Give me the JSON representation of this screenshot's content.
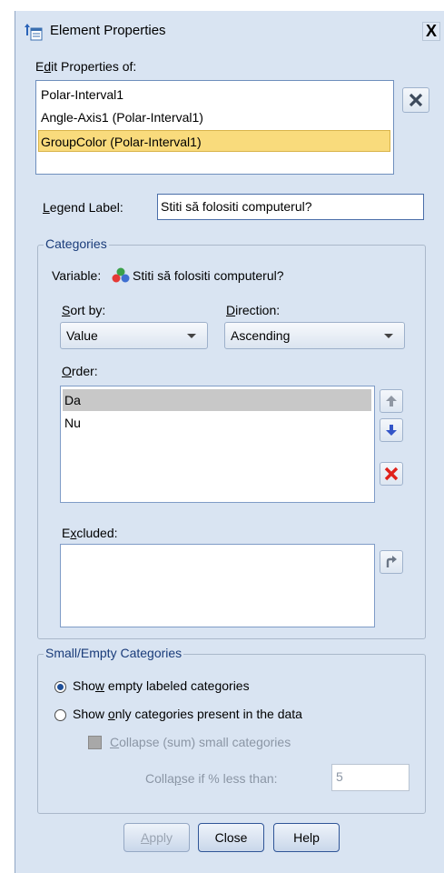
{
  "window": {
    "title": "Element Properties",
    "close_glyph": "X"
  },
  "edit_properties": {
    "label_pre": "E",
    "label_u": "d",
    "label_post": "it Properties of:",
    "items": [
      "Polar-Interval1",
      "Angle-Axis1 (Polar-Interval1)",
      "GroupColor (Polar-Interval1)"
    ],
    "selected_index": 2
  },
  "legend_label": {
    "label_u": "L",
    "label_post": "egend Label:",
    "value": "Stiti să folositi computerul?"
  },
  "categories": {
    "group_title": "Categories",
    "variable_label": "Variable:",
    "variable_icon": "nominal-variable-icon",
    "variable_name": "Stiti să folositi computerul?",
    "sort_by_u": "S",
    "sort_by_post": "ort by:",
    "sort_by_value": "Value",
    "direction_u": "D",
    "direction_post": "irection:",
    "direction_value": "Ascending",
    "order_u": "O",
    "order_post": "rder:",
    "order_items": [
      "Da",
      "Nu"
    ],
    "excluded_pre": "E",
    "excluded_u": "x",
    "excluded_post": "cluded:",
    "excluded_items": []
  },
  "small_empty": {
    "group_title": "Small/Empty Categories",
    "opt1_pre": "Sho",
    "opt1_u": "w",
    "opt1_post": " empty labeled categories",
    "opt1_selected": true,
    "opt2_pre": "Show ",
    "opt2_u": "o",
    "opt2_post": "nly categories present in the data",
    "collapse_u": "C",
    "collapse_post": "ollapse (sum) small categories",
    "collapse_if_pre": "Colla",
    "collapse_if_u": "p",
    "collapse_if_post": "se if % less than:",
    "collapse_if_value": "5"
  },
  "buttons": {
    "apply_u": "A",
    "apply_post": "pply",
    "close": "Close",
    "help": "Help"
  },
  "colors": {
    "dialog_bg": "#d9e4f2",
    "selected_row": "#f9db7c",
    "order_selected": "#c8c8c8",
    "group_title": "#1a3c7a"
  }
}
